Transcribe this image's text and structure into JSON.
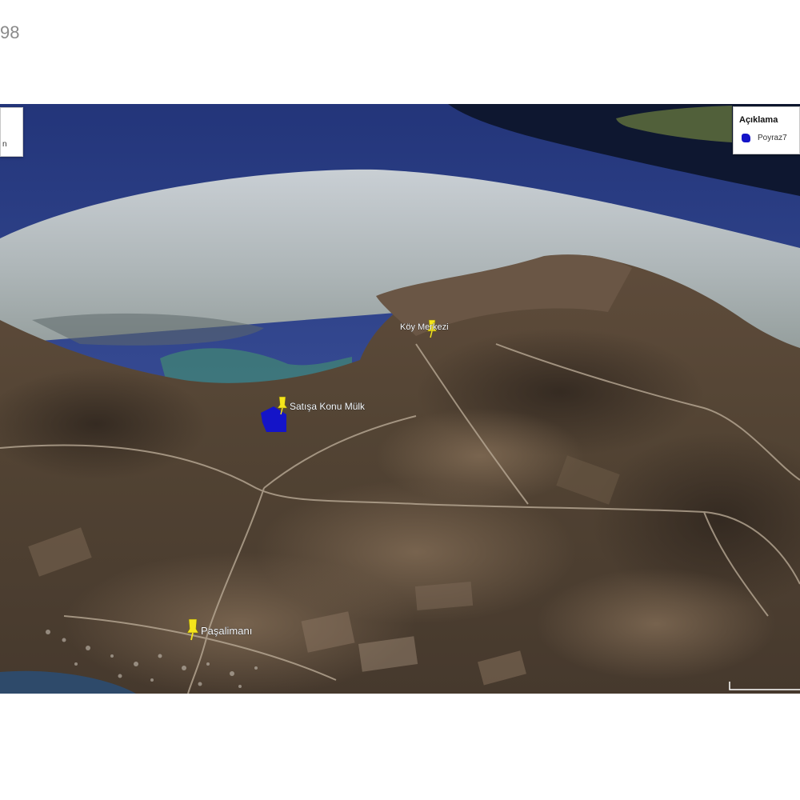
{
  "page": {
    "number_fragment": "98"
  },
  "map": {
    "left_panel_text": "n",
    "legend": {
      "title": "Açıklama",
      "items": [
        {
          "label": "Poyraz7",
          "color": "#1414c8"
        }
      ]
    },
    "placemarks": [
      {
        "label": "Köy Merkezi",
        "icon": "yellow-pushpin-icon",
        "color": "#f5e51b"
      },
      {
        "label": "Satışa Konu Mülk",
        "icon": "yellow-pushpin-icon",
        "color": "#f5e51b"
      },
      {
        "label": "Paşalimanı",
        "icon": "yellow-pushpin-icon",
        "color": "#f5e51b"
      }
    ],
    "polygon": {
      "name": "Poyraz7",
      "color": "#1414c8"
    }
  }
}
